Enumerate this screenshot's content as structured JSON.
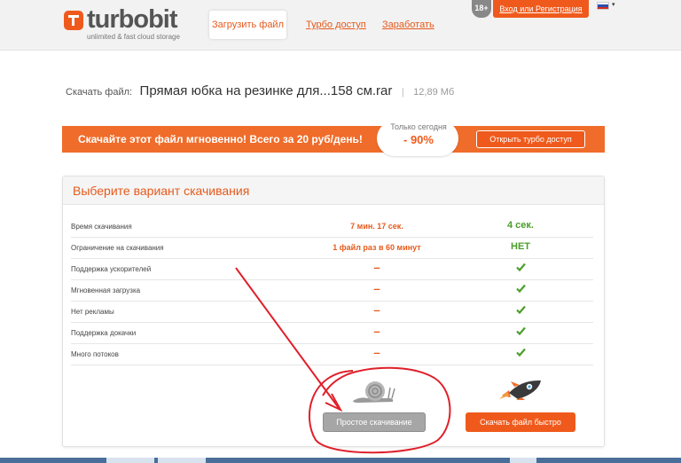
{
  "header": {
    "logo_text": "turbobit",
    "logo_tagline": "unlimited & fast cloud storage",
    "nav": [
      {
        "label": "Загрузить файл"
      },
      {
        "label": "Турбо доступ"
      },
      {
        "label": "Заработать"
      }
    ],
    "age_badge": "18+",
    "login_label": "Вход или Регистрация",
    "language": "ru"
  },
  "file": {
    "label": "Скачать файл:",
    "name": "Прямая юбка на резинке для...158 см.rar",
    "separator": "|",
    "size": "12,89 Мб"
  },
  "banner": {
    "text": "Скачайте этот файл мгновенно! Всего за 20 руб/день!",
    "promo_line1": "Только сегодня",
    "promo_line2": "- 90%",
    "button_label": "Открыть турбо доступ"
  },
  "panel": {
    "title": "Выберите вариант скачивания",
    "rows": [
      {
        "label": "Время скачивания",
        "free": "7 мин. 17 сек.",
        "turbo": "4 сек."
      },
      {
        "label": "Ограничение на скачивания",
        "free": "1 файл раз в 60 минут",
        "turbo": "НЕТ"
      },
      {
        "label": "Поддержка ускорителей",
        "free": "–",
        "turbo": "check"
      },
      {
        "label": "Мгновенная загрузка",
        "free": "–",
        "turbo": "check"
      },
      {
        "label": "Нет рекламы",
        "free": "–",
        "turbo": "check"
      },
      {
        "label": "Поддержка докачки",
        "free": "–",
        "turbo": "check"
      },
      {
        "label": "Много потоков",
        "free": "–",
        "turbo": "check"
      }
    ],
    "slow_button": "Простое скачивание",
    "fast_button": "Скачать файл быстро"
  },
  "colors": {
    "accent": "#ef5a1c",
    "check": "#4a9e2a",
    "annotation": "#e0202a"
  },
  "icons": {
    "slow": "snail-icon",
    "fast": "rocket-icon",
    "check": "check-icon"
  }
}
